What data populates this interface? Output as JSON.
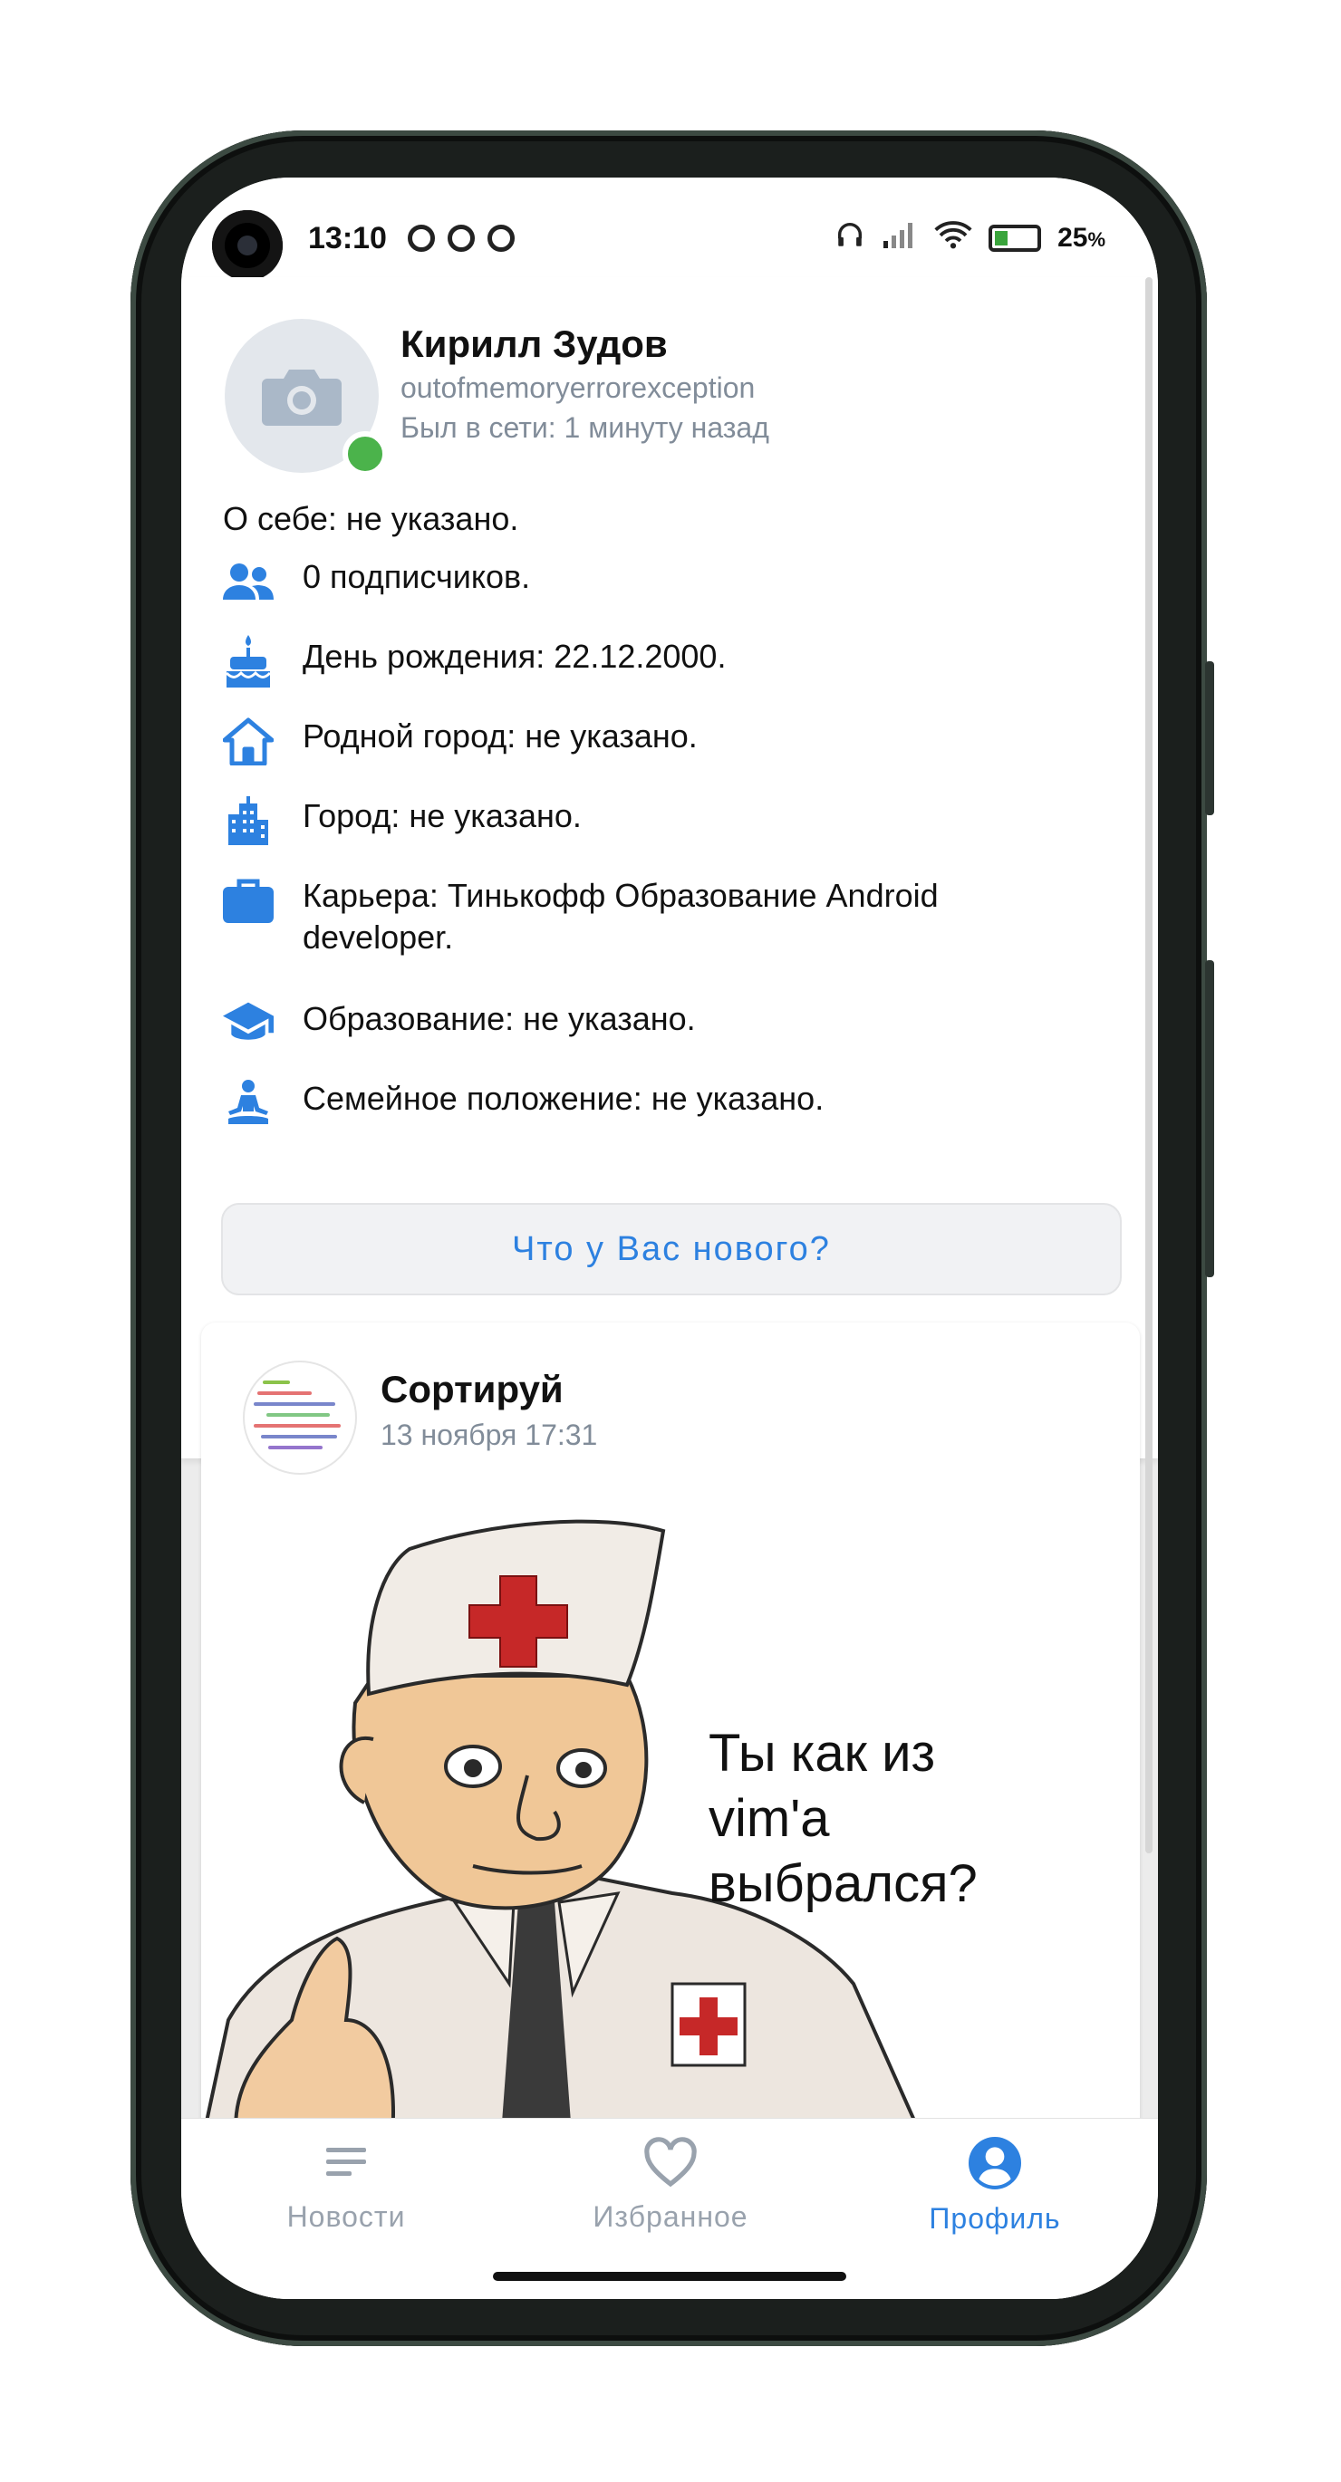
{
  "status_bar": {
    "time": "13:10",
    "battery": "25",
    "battery_unit": "%",
    "icons": [
      "media-icon",
      "sync-icon",
      "sync-icon",
      "headphones-icon",
      "signal-icon",
      "wifi-icon",
      "battery-icon"
    ]
  },
  "profile": {
    "name": "Кирилл Зудов",
    "login": "outofmemoryerrorexception",
    "last_seen": "Был в сети: 1 минуту назад",
    "about": "О себе: не указано.",
    "info": [
      {
        "icon": "followers-icon",
        "text": "0 подписчиков."
      },
      {
        "icon": "birthday-cake-icon",
        "text": "День рождения: 22.12.2000."
      },
      {
        "icon": "home-icon",
        "text": "Родной город: не указано."
      },
      {
        "icon": "city-icon",
        "text": "Город: не указано."
      },
      {
        "icon": "briefcase-icon",
        "text": "Карьера: Тинькофф Образование Android developer."
      },
      {
        "icon": "graduation-cap-icon",
        "text": "Образование: не указано."
      },
      {
        "icon": "meditation-icon",
        "text": "Семейное положение: не указано."
      }
    ],
    "new_post_label": "Что у Вас нового?"
  },
  "post": {
    "author": "Сортируй",
    "date": "13 ноября 17:31",
    "image_text": "Ты как из vim'a выбрался?"
  },
  "bottom_nav": {
    "items": [
      {
        "label": "Новости",
        "icon": "news-icon",
        "active": false
      },
      {
        "label": "Избранное",
        "icon": "heart-icon",
        "active": false
      },
      {
        "label": "Профиль",
        "icon": "profile-icon",
        "active": true
      }
    ]
  },
  "colors": {
    "accent": "#2d81e0",
    "online": "#4bb34b",
    "secondary_text": "#818c99",
    "inactive_nav": "#99a2ad"
  }
}
